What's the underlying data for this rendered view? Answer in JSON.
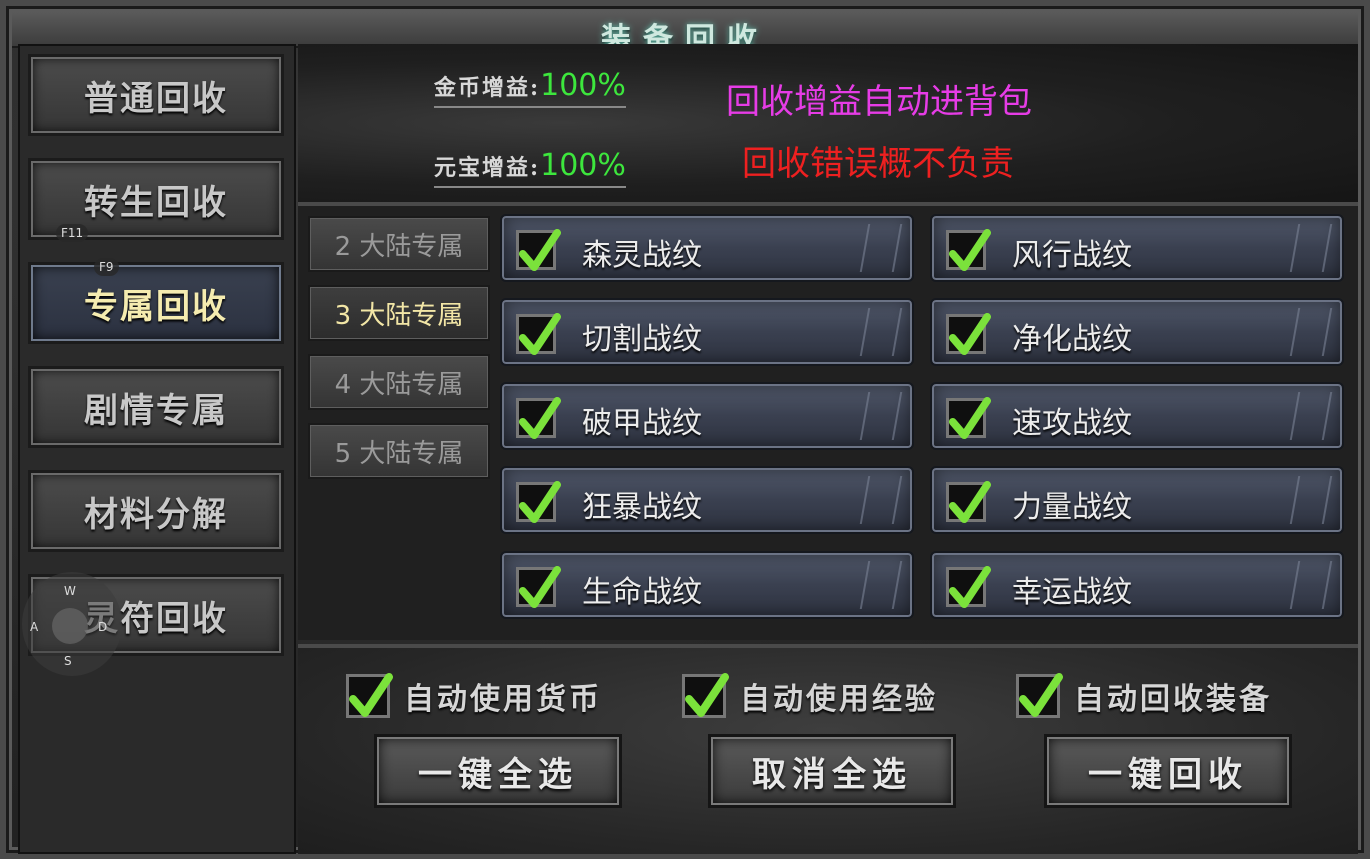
{
  "window": {
    "title": "装备回收"
  },
  "menu": [
    {
      "label": "普通回收",
      "active": false
    },
    {
      "label": "转生回收",
      "active": false
    },
    {
      "label": "专属回收",
      "active": true
    },
    {
      "label": "剧情专属",
      "active": false
    },
    {
      "label": "材料分解",
      "active": false
    },
    {
      "label": "灵符回收",
      "active": false
    }
  ],
  "hotkeys": {
    "f11": "F11",
    "f9": "F9"
  },
  "joystick": {
    "up": "W",
    "left": "A",
    "right": "D",
    "down": "S"
  },
  "bonus": {
    "gold_label": "金币增益:",
    "gold_value": "100%",
    "ingot_label": "元宝增益:",
    "ingot_value": "100%"
  },
  "notices": {
    "auto_bag": "回收增益自动进背包",
    "disclaimer": "回收错误概不负责"
  },
  "continents": [
    {
      "label": "2 大陆专属",
      "active": false
    },
    {
      "label": "3 大陆专属",
      "active": true
    },
    {
      "label": "4 大陆专属",
      "active": false
    },
    {
      "label": "5 大陆专属",
      "active": false
    }
  ],
  "items": [
    {
      "label": "森灵战纹",
      "checked": true
    },
    {
      "label": "风行战纹",
      "checked": true
    },
    {
      "label": "切割战纹",
      "checked": true
    },
    {
      "label": "净化战纹",
      "checked": true
    },
    {
      "label": "破甲战纹",
      "checked": true
    },
    {
      "label": "速攻战纹",
      "checked": true
    },
    {
      "label": "狂暴战纹",
      "checked": true
    },
    {
      "label": "力量战纹",
      "checked": true
    },
    {
      "label": "生命战纹",
      "checked": true
    },
    {
      "label": "幸运战纹",
      "checked": true
    }
  ],
  "options": [
    {
      "label": "自动使用货币",
      "checked": true
    },
    {
      "label": "自动使用经验",
      "checked": true
    },
    {
      "label": "自动回收装备",
      "checked": true
    }
  ],
  "actions": {
    "select_all": "一键全选",
    "deselect_all": "取消全选",
    "recycle": "一键回收"
  },
  "colors": {
    "check": "#7be23b",
    "gold_value": "#3de63d",
    "notice_magenta": "#e63ce6",
    "notice_red": "#ee2020"
  }
}
